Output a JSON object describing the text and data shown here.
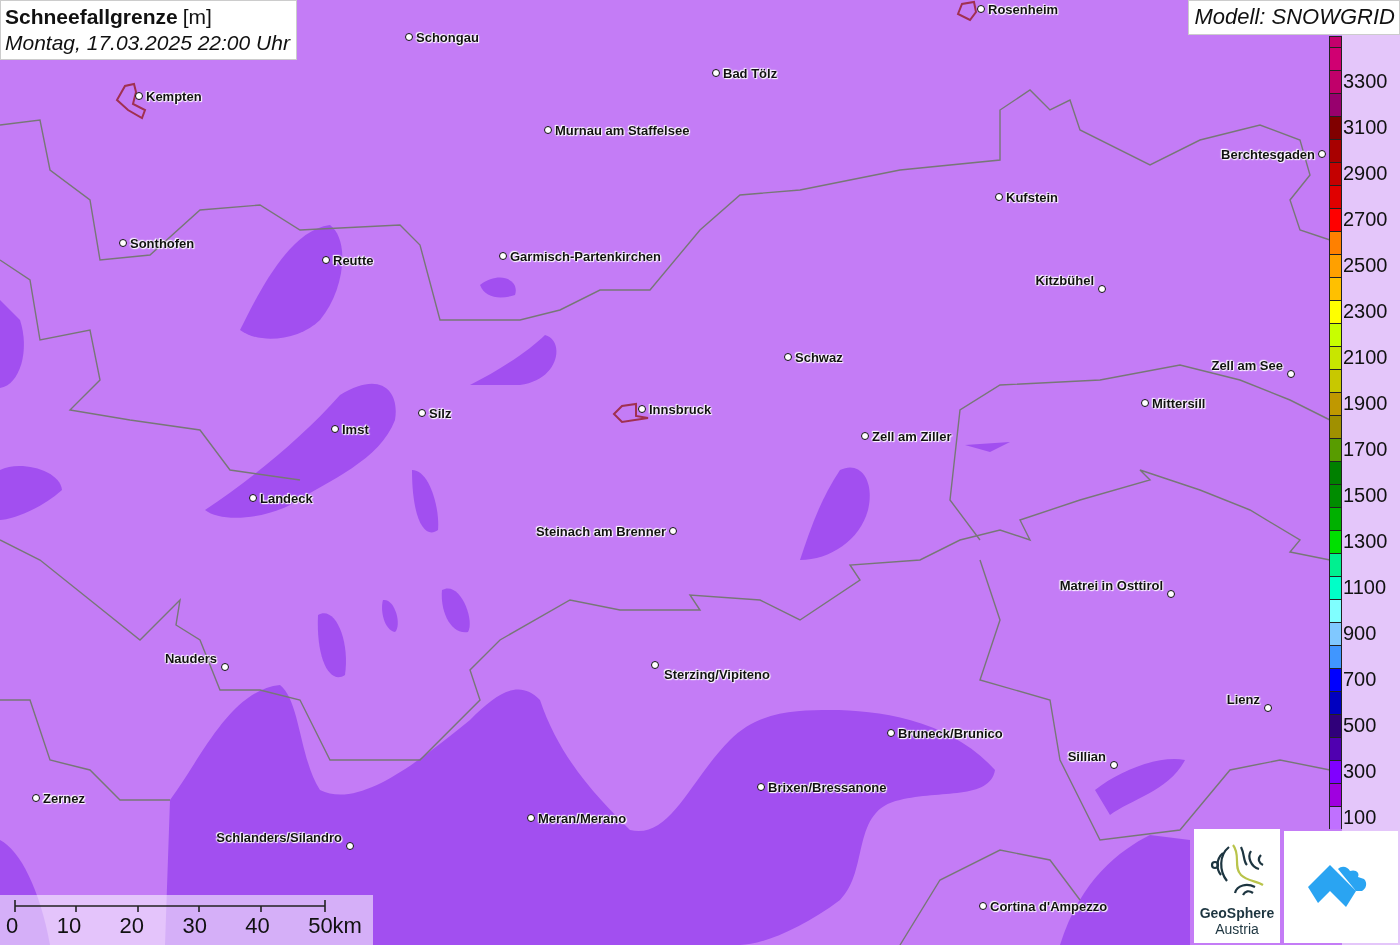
{
  "header": {
    "title": "Schneefallgrenze",
    "unit": "[m]",
    "datetime": "Montag, 17.03.2025 22:00 Uhr"
  },
  "model": "Modell: SNOWGRID",
  "cities": [
    {
      "name": "Rosenheim"
    },
    {
      "name": "Schongau"
    },
    {
      "name": "Bad Tölz"
    },
    {
      "name": "Kempten"
    },
    {
      "name": "Murnau am Staffelsee"
    },
    {
      "name": "Berchtesgaden"
    },
    {
      "name": "Kufstein"
    },
    {
      "name": "Sonthofen"
    },
    {
      "name": "Reutte"
    },
    {
      "name": "Garmisch-Partenkirchen"
    },
    {
      "name": "Kitzbühel"
    },
    {
      "name": "Schwaz"
    },
    {
      "name": "Zell am See"
    },
    {
      "name": "Mittersill"
    },
    {
      "name": "Innsbruck"
    },
    {
      "name": "Silz"
    },
    {
      "name": "Imst"
    },
    {
      "name": "Zell am Ziller"
    },
    {
      "name": "Landeck"
    },
    {
      "name": "Steinach am Brenner"
    },
    {
      "name": "Matrei in Osttirol"
    },
    {
      "name": "Nauders"
    },
    {
      "name": "Sterzing/Vipiteno"
    },
    {
      "name": "Lienz"
    },
    {
      "name": "Bruneck/Brunico"
    },
    {
      "name": "Sillian"
    },
    {
      "name": "Brixen/Bressanone"
    },
    {
      "name": "Zernez"
    },
    {
      "name": "Meran/Merano"
    },
    {
      "name": "Schlanders/Silandro"
    },
    {
      "name": "Cortina d'Ampezzo"
    }
  ],
  "legend": {
    "bands": [
      {
        "color": "#c4006c"
      },
      {
        "color": "#d00072"
      },
      {
        "color": "#c0006a",
        "label": "3300"
      },
      {
        "color": "#98006e"
      },
      {
        "color": "#800000",
        "label": "3100"
      },
      {
        "color": "#a80000"
      },
      {
        "color": "#c40000",
        "label": "2900"
      },
      {
        "color": "#e00000"
      },
      {
        "color": "#ff0000",
        "label": "2700"
      },
      {
        "color": "#ff8000"
      },
      {
        "color": "#ffa000",
        "label": "2500"
      },
      {
        "color": "#ffc000"
      },
      {
        "color": "#ffff00",
        "label": "2300"
      },
      {
        "color": "#c8ff00"
      },
      {
        "color": "#c8e600",
        "label": "2100"
      },
      {
        "color": "#c8c800"
      },
      {
        "color": "#c09800",
        "label": "1900"
      },
      {
        "color": "#a09000"
      },
      {
        "color": "#589c00",
        "label": "1700"
      },
      {
        "color": "#008000"
      },
      {
        "color": "#008c00",
        "label": "1500"
      },
      {
        "color": "#00b000"
      },
      {
        "color": "#00e000",
        "label": "1300"
      },
      {
        "color": "#00f090"
      },
      {
        "color": "#00ffc8",
        "label": "1100"
      },
      {
        "color": "#80ffff"
      },
      {
        "color": "#80c8ff",
        "label": "900"
      },
      {
        "color": "#4096ff"
      },
      {
        "color": "#0000ff",
        "label": "700"
      },
      {
        "color": "#0000c0"
      },
      {
        "color": "#30007a",
        "label": "500"
      },
      {
        "color": "#5000b0"
      },
      {
        "color": "#8000ff",
        "label": "300"
      },
      {
        "color": "#a000e0"
      },
      {
        "color": "#c070ff",
        "label": "100"
      }
    ]
  },
  "scale": {
    "labels": [
      "0",
      "10",
      "20",
      "30",
      "40",
      "50km"
    ]
  },
  "logos": {
    "geosphere": {
      "name": "GeoSphere",
      "country": "Austria"
    }
  }
}
